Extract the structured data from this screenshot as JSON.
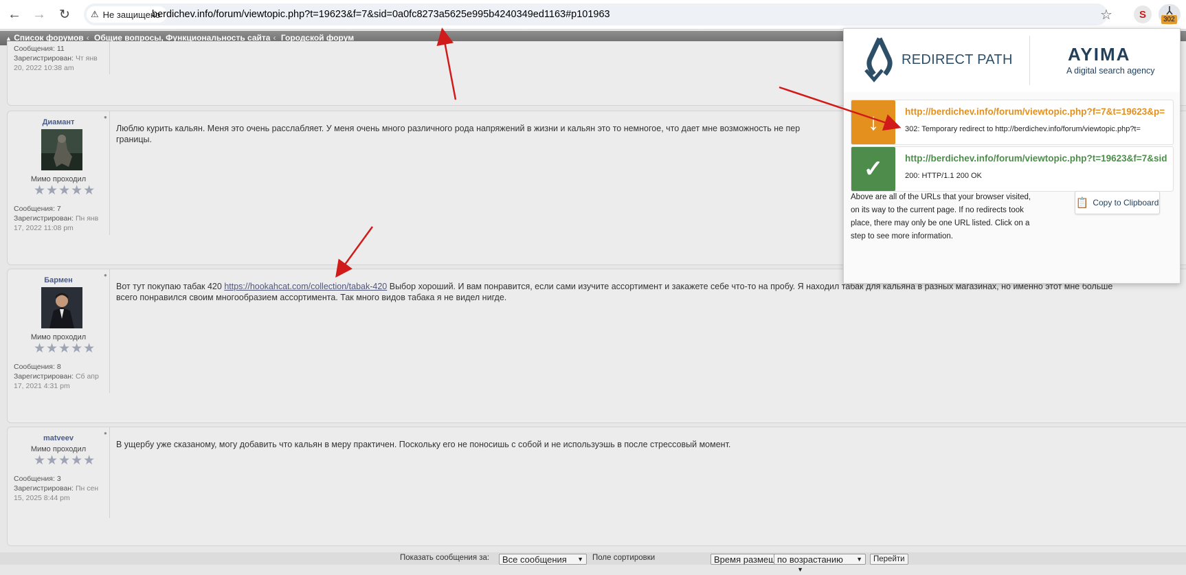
{
  "browser": {
    "security_label": "Не защищено",
    "url_host": "berdichev.info",
    "url_rest": "/forum/viewtopic.php?t=19623&f=7&sid=0a0fc8273a5625e995b4240349ed1163#p101963",
    "badge_count": "302"
  },
  "breadcrumb": {
    "items": [
      "Список форумов",
      "Общие вопросы, Функциональность сайта",
      "Городской форум"
    ]
  },
  "posts": [
    {
      "meta_posts": "Сообщения: 11",
      "meta_registered_label": "Зарегистрирован:",
      "meta_registered_value": "Чт янв 20, 2022 10:38 am"
    },
    {
      "username": "Диамант",
      "rank": "Мимо проходил",
      "rating": 0,
      "meta_posts": "Сообщения: 7",
      "meta_registered_label": "Зарегистрирован:",
      "meta_registered_value": "Пн янв 17, 2022 11:08 pm",
      "text_line1": "Люблю курить кальян. Меня это очень расслабляет. У меня очень много различного рода напряжений в жизни и кальян это то немногое, что дает мне возможность не пер",
      "text_line2": "границы."
    },
    {
      "username": "Бармен",
      "rank": "Мимо проходил",
      "rating": 0,
      "meta_posts": "Сообщения: 8",
      "meta_registered_label": "Зарегистрирован:",
      "meta_registered_value": "Сб апр 17, 2021 4:31 pm",
      "text_before_link": "Вот тут покупаю табак 420 ",
      "link": "https://hookahcat.com/collection/tabak-420",
      "text_after_link": " Выбор хороший. И вам понравится, если сами изучите ассортимент и закажете себе что-то на пробу. Я находил табак для кальяна в разных магазинах, но именно этот мне больше",
      "text_line2": "всего понравился своим многообразием ассортимента. Так много видов табака я не видел нигде."
    },
    {
      "username": "matveev",
      "rank": "Мимо проходил",
      "rating": 0,
      "meta_posts": "Сообщения: 3",
      "meta_registered_label": "Зарегистрирован:",
      "meta_registered_value": "Пн сен 15, 2025 8:44 pm",
      "text_line1": "В ущербу уже сказаному, могу добавить что кальян в меру практичен. Поскольку его не поносишь с собой и не используэшь в после стрессовый момент."
    }
  ],
  "sortbar": {
    "show_label": "Показать сообщения за:",
    "show_value": "Все сообщения",
    "sort_label": "Поле сортировки",
    "sort_value": "Время размещения",
    "order_value": "по возрастанию",
    "go_label": "Перейти"
  },
  "redirect_path": {
    "logo_text": "REDIRECT PATH",
    "ayima": "AYIMA",
    "ayima_sub": "A digital search agency",
    "items": [
      {
        "url": "http://berdichev.info/forum/viewtopic.php?f=7&t=19623&p=",
        "status": "302: Temporary redirect to http://berdichev.info/forum/viewtopic.php?t=",
        "color": "#e3901f",
        "icon": "arrow-down-icon"
      },
      {
        "url": "http://berdichev.info/forum/viewtopic.php?t=19623&f=7&sid",
        "status": "200: HTTP/1.1 200 OK",
        "color": "#4e8c4c",
        "icon": "check-icon"
      }
    ],
    "description": "Above are all of the URLs that your browser visited, on its way to the current page. If no redirects took place, there may only be one URL listed. Click on a step to see more information.",
    "copy_label": "Copy to Clipboard"
  }
}
